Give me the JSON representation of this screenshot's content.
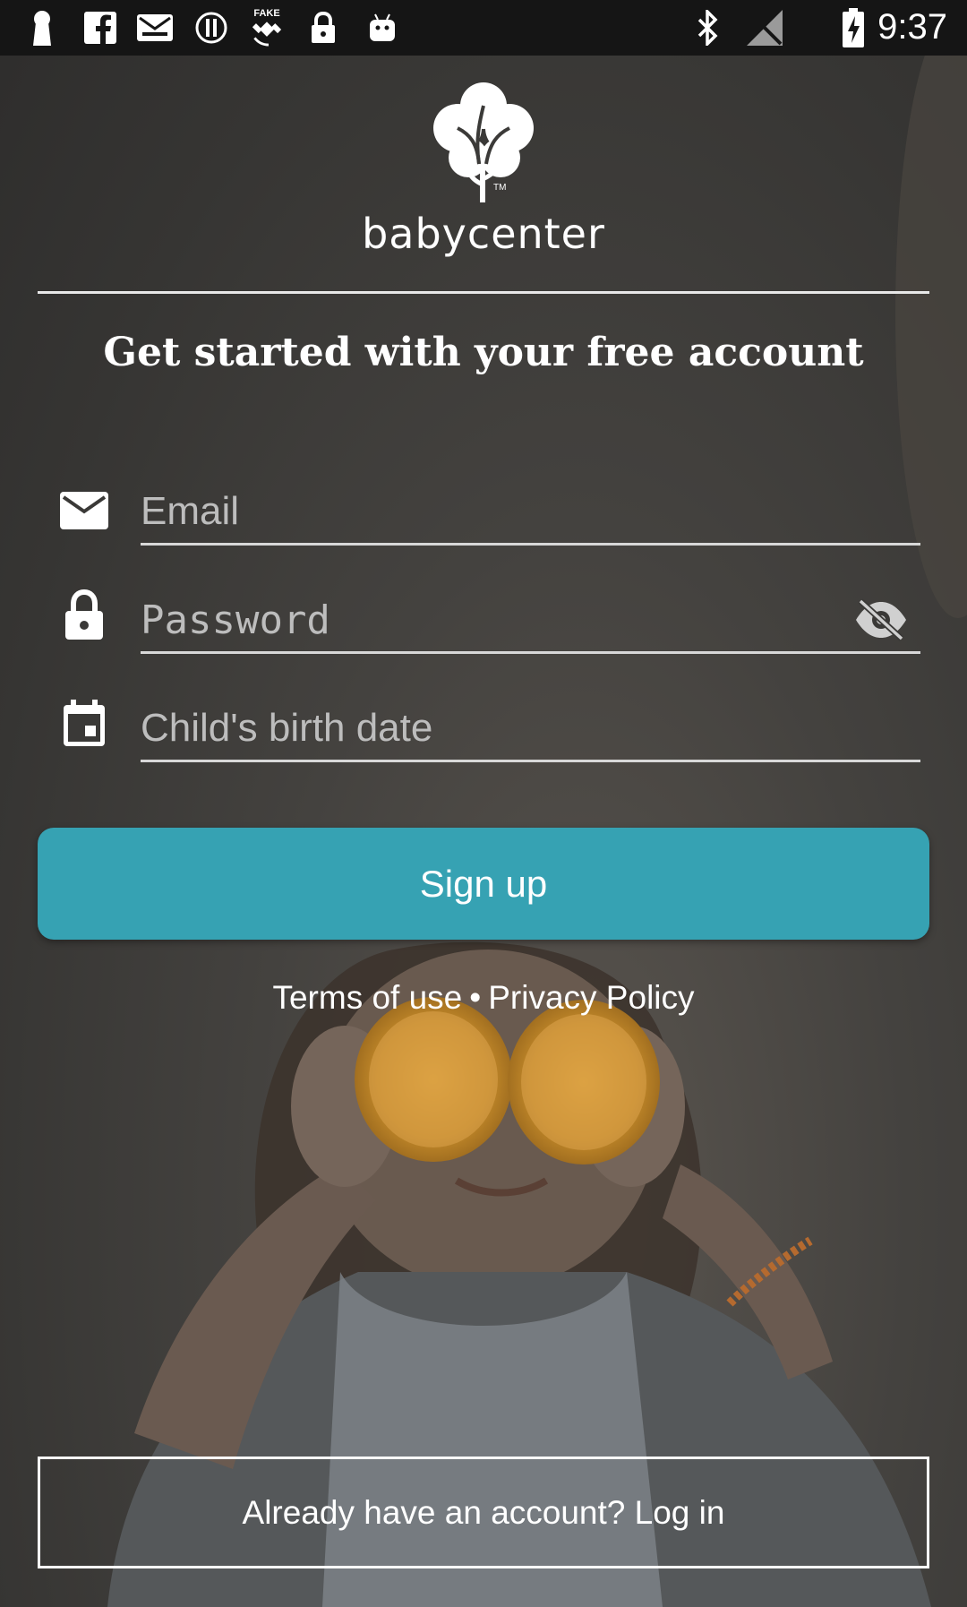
{
  "status_bar": {
    "time": "9:37",
    "icons": [
      "keyhole-icon",
      "facebook-icon",
      "mail-icon",
      "alert-icon",
      "fake-gps-icon",
      "lock-icon",
      "android-icon",
      "bluetooth-icon",
      "no-signal-icon",
      "battery-charging-icon"
    ],
    "fake_label": "FAKE"
  },
  "brand": {
    "name": "babycenter",
    "trademark": "TM"
  },
  "headline": "Get started with your free account",
  "form": {
    "email": {
      "placeholder": "Email",
      "value": "",
      "icon": "mail-icon"
    },
    "password": {
      "placeholder": "Password",
      "value": "",
      "icon": "lock-icon",
      "toggle_icon": "eye-off-icon"
    },
    "birth_date": {
      "placeholder": "Child's birth date",
      "value": "",
      "icon": "calendar-icon"
    }
  },
  "signup_button": {
    "label": "Sign up",
    "color": "#36a2b3"
  },
  "legal": {
    "terms": "Terms of use",
    "separator": "•",
    "privacy": "Privacy Policy"
  },
  "login_button": {
    "label": "Already have an account? Log in"
  }
}
